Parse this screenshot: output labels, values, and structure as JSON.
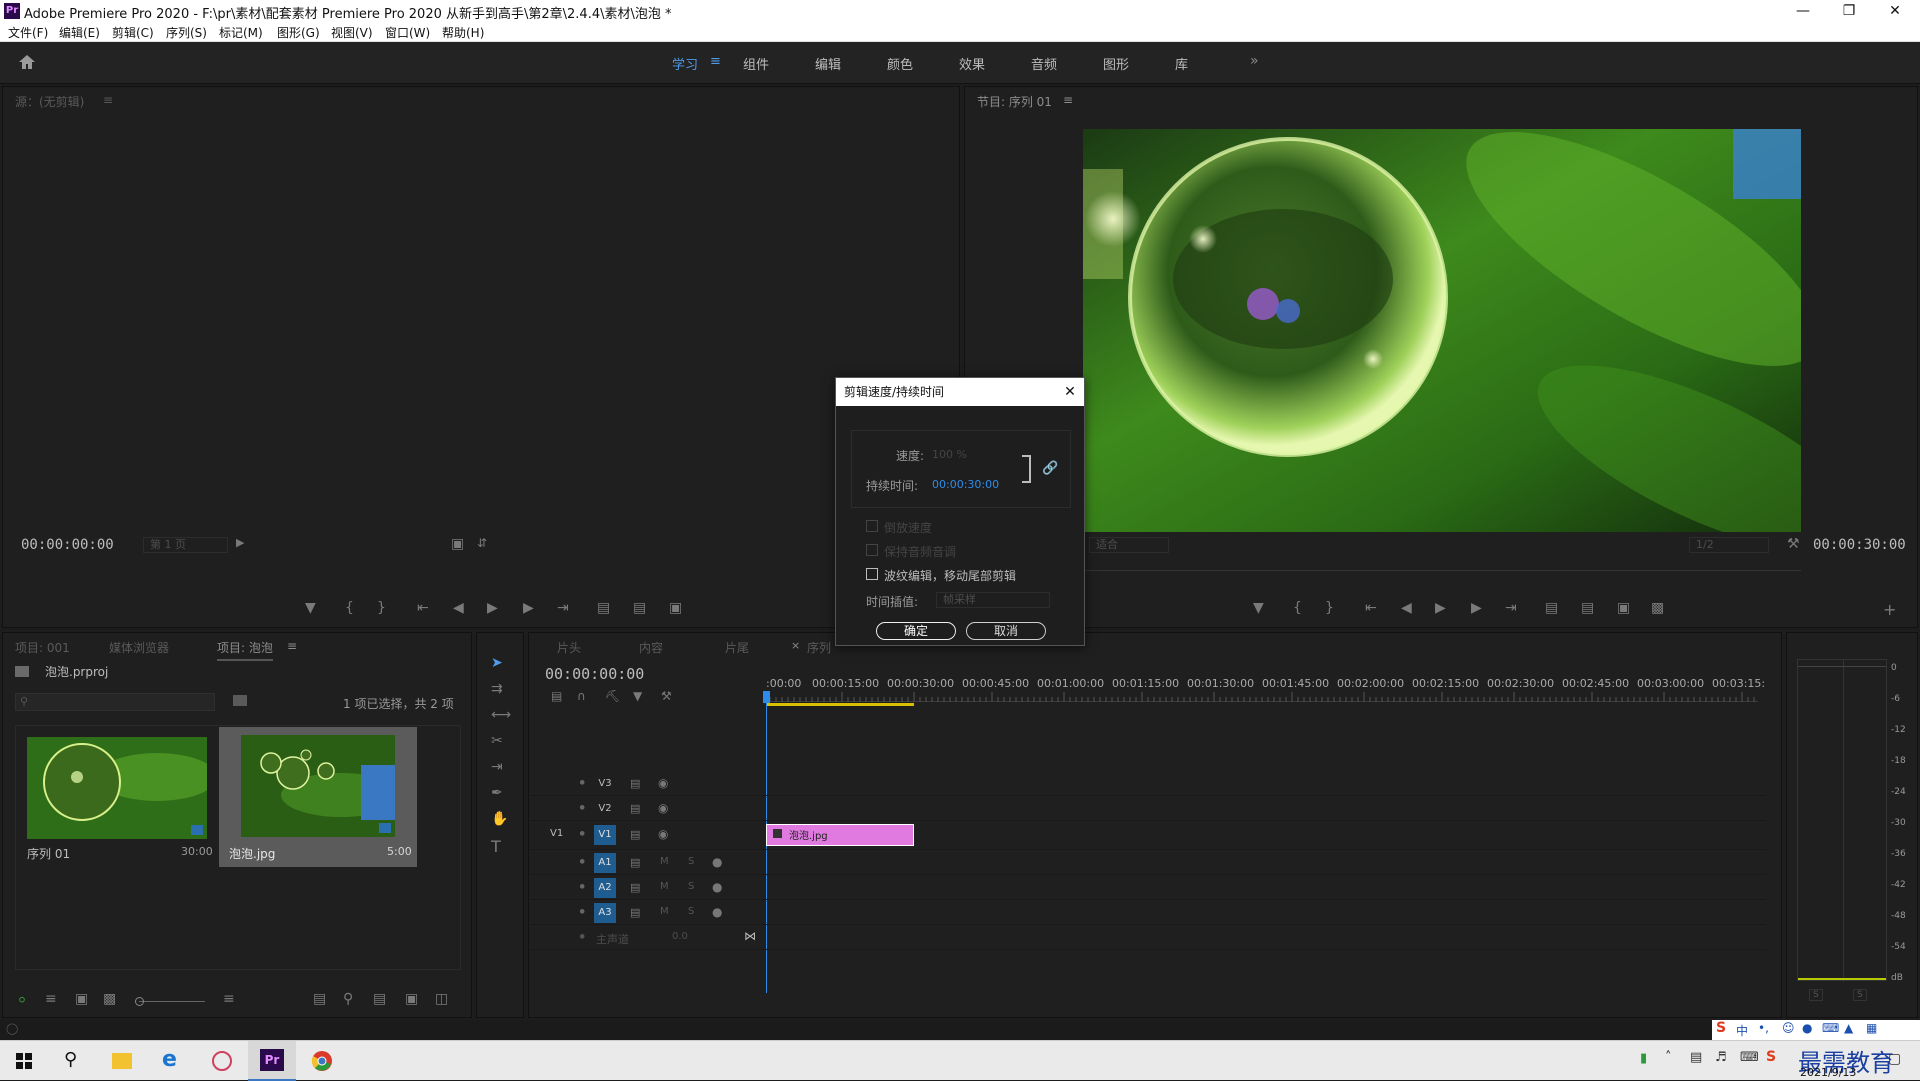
{
  "app": {
    "logo": "Pr",
    "title": "Adobe Premiere Pro 2020 - F:\\pr\\素材\\配套素材 Premiere Pro 2020 从新手到高手\\第2章\\2.4.4\\素材\\泡泡 *"
  },
  "menu": [
    "文件(F)",
    "编辑(E)",
    "剪辑(C)",
    "序列(S)",
    "标记(M)",
    "图形(G)",
    "视图(V)",
    "窗口(W)",
    "帮助(H)"
  ],
  "workspaces": [
    "学习",
    "组件",
    "编辑",
    "颜色",
    "效果",
    "音频",
    "图形",
    "库"
  ],
  "source": {
    "title": "源：(无剪辑)",
    "timecode": "00:00:00:00",
    "page": "第 1 页"
  },
  "program": {
    "title": "节目: 序列 01",
    "timecode": "00:00:30:00",
    "fit": "适合",
    "ratio": "1/2"
  },
  "project": {
    "tabs": [
      "项目: 001",
      "媒体浏览器",
      "项目: 泡泡"
    ],
    "file": "泡泡.prproj",
    "selection": "1 项已选择，共 2 项",
    "items": [
      {
        "name": "序列 01",
        "duration": "30:00"
      },
      {
        "name": "泡泡.jpg",
        "duration": "5:00"
      }
    ]
  },
  "timeline": {
    "tabs": [
      "片头",
      "内容",
      "片尾",
      "序列"
    ],
    "timecode": "00:00:00:00",
    "ruler": [
      ":00:00",
      "00:00:15:00",
      "00:00:30:00",
      "00:00:45:00",
      "00:01:00:00",
      "00:01:15:00",
      "00:01:30:00",
      "00:01:45:00",
      "00:02:00:00",
      "00:02:15:00",
      "00:02:30:00",
      "00:02:45:00",
      "00:03:00:00",
      "00:03:15:"
    ],
    "video_tracks": [
      "V3",
      "V2",
      "V1"
    ],
    "audio_tracks": [
      "A1",
      "A2",
      "A3"
    ],
    "src_v1": "V1",
    "mute": "M",
    "solo": "S",
    "master": "主声道",
    "master_val": "0.0",
    "clip_label": "泡泡.jpg",
    "clip_color": "#e07ae0"
  },
  "meter": {
    "scale": [
      "0",
      "-6",
      "-12",
      "-18",
      "-24",
      "-30",
      "-36",
      "-42",
      "-48",
      "-54",
      "dB"
    ],
    "solo": "S"
  },
  "dialog": {
    "title": "剪辑速度/持续时间",
    "speed_label": "速度:",
    "speed_value": "100 %",
    "duration_label": "持续时间:",
    "duration_value": "00:00:30:00",
    "reverse": "倒放速度",
    "maintain_pitch": "保持音频音调",
    "ripple": "波纹编辑，移动尾部剪辑",
    "interp_label": "时间插值:",
    "interp_value": "帧采样",
    "ok": "确定",
    "cancel": "取消"
  },
  "taskbar": {
    "ime": "中",
    "date": "2021/9/13",
    "watermark": "最需教育"
  }
}
